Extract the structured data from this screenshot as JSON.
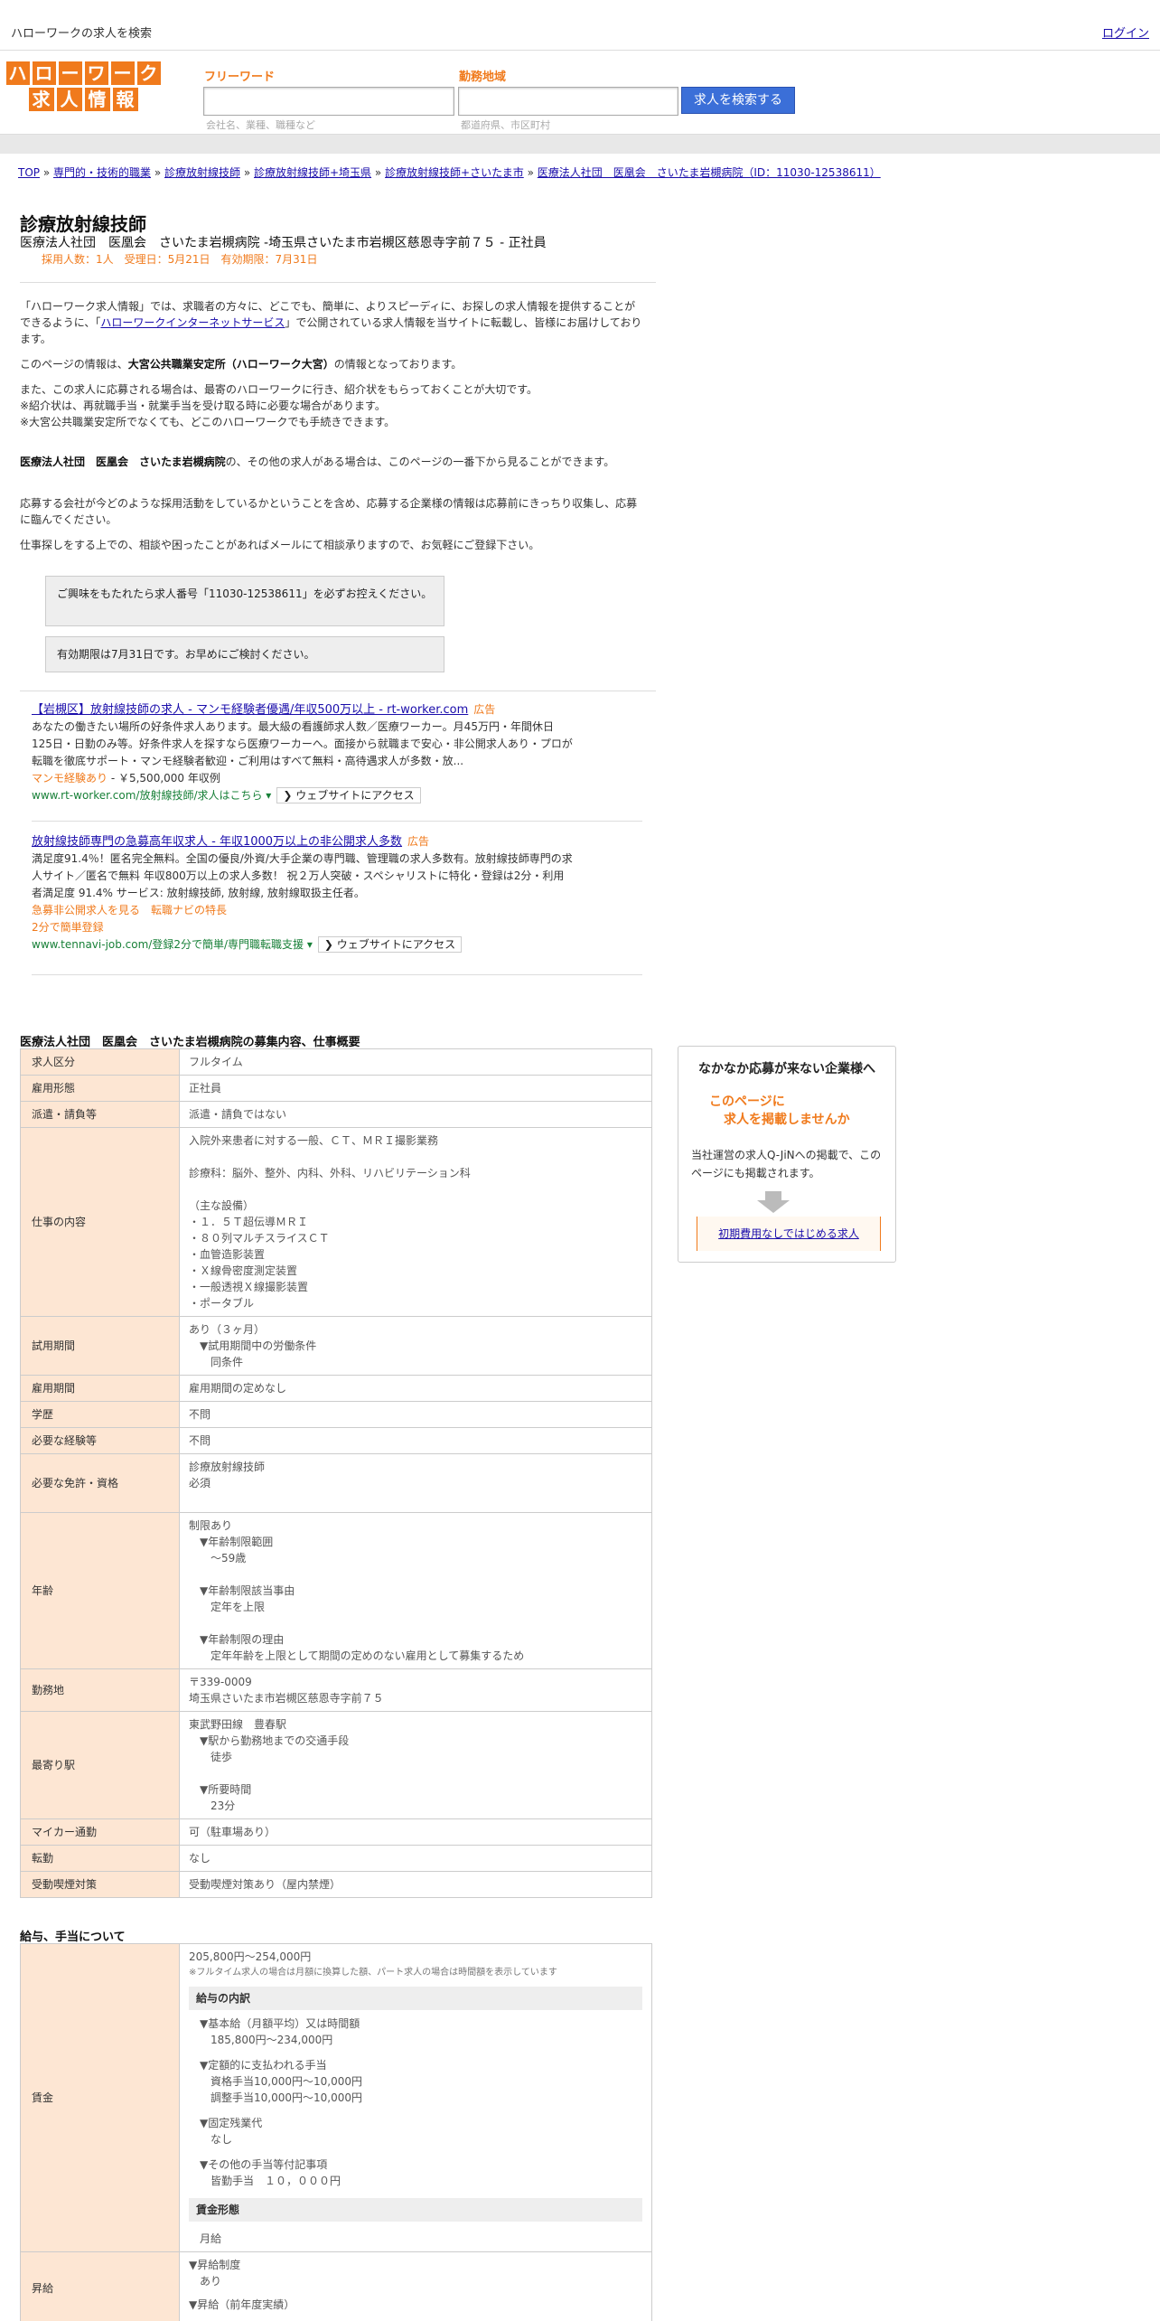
{
  "topbar": {
    "title": "ハローワークの求人を検索",
    "login": "ログイン"
  },
  "logo": {
    "row1": [
      "ハ",
      "ロ",
      "ー",
      "ワ",
      "ー",
      "ク"
    ],
    "row2": [
      "求",
      "人",
      "情",
      "報"
    ]
  },
  "search": {
    "freeword_label": "フリーワード",
    "freeword_hint": "会社名、業種、職種など",
    "area_label": "勤務地域",
    "area_hint": "都道府県、市区町村",
    "button": "求人を検索する"
  },
  "breadcrumb": {
    "items": [
      "TOP",
      "専門的・技術的職業",
      "診療放射線技師",
      "診療放射線技師+埼玉県",
      "診療放射線技師+さいたま市",
      "医療法人社団　医凰会　さいたま岩槻病院（ID：11030-12538611）"
    ],
    "sep": "»"
  },
  "job": {
    "title": "診療放射線技師",
    "subtitle": "医療法人社団　医凰会　さいたま岩槻病院 -埼玉県さいたま市岩槻区慈恩寺字前７５ - 正社員",
    "meta": "採用人数：1人　受理日：5月21日　有効期限：7月31日"
  },
  "intro": {
    "p1a": "「ハローワーク求人情報」では、求職者の方々に、どこでも、簡単に、よりスピーディに、お探しの求人情報を提供することができるように、「",
    "p1link": "ハローワークインターネットサービス",
    "p1b": "」で公開されている求人情報を当サイトに転載し、皆様にお届けしております。",
    "p2a": "このページの情報は、",
    "p2b": "大宮公共職業安定所（ハローワーク大宮）",
    "p2c": "の情報となっております。",
    "p3": [
      "また、この求人に応募される場合は、最寄のハローワークに行き、紹介状をもらっておくことが大切です。",
      "※紹介状は、再就職手当・就業手当を受け取る時に必要な場合があります。",
      "※大宮公共職業安定所でなくても、どこのハローワークでも手続きできます。"
    ],
    "p4a": "医療法人社団　医凰会　さいたま岩槻病院",
    "p4b": "の、その他の求人がある場合は、このページの一番下から見ることができます。",
    "p5": "応募する会社が今どのような採用活動をしているかということを含め、応募する企業様の情報は応募前にきっちり収集し、応募に臨んでください。",
    "p6": "仕事探しをする上での、相談や困ったことがあればメールにて相談承りますので、お気軽にご登録下さい。"
  },
  "notice": {
    "box1": "ご興味をもたれたら求人番号「11030-12538611」を必ずお控えください。",
    "box2": "有効期限は7月31日です。お早めにご検討ください。"
  },
  "ads": [
    {
      "title": "【岩槻区】放射線技師の求人 - マンモ経験者優遇/年収500万以上 - rt-worker.com",
      "badge": "広告",
      "desc": "あなたの働きたい場所の好条件求人あります。最大級の看護師求人数／医療ワーカー。月45万円・年間休日125日・日勤のみ等。好条件求人を探すなら医療ワーカーへ。面接から就職まで安心・非公開求人あり・プロが転職を徹底サポート・マンモ経験者歓迎・ご利用はすべて無料・高待遇求人が多数・放...",
      "ext1": "マンモ経験あり",
      "ext1b": " - ￥5,500,000 年収例",
      "ext2": "",
      "url": "www.rt-worker.com/放射線技師/求人はこちら",
      "visit": "❯ ウェブサイトにアクセス"
    },
    {
      "title": "放射線技師専門の急募高年収求人 - 年収1000万以上の非公開求人多数",
      "badge": "広告",
      "desc": "満足度91.4％！匿名完全無料。全国の優良/外資/大手企業の専門職、管理職の求人多数有。放射線技師専門の求人サイト／匿名で無料 年収800万以上の求人多数！ 祝２万人突破・スペシャリストに特化・登録は2分・利用者満足度 91.4% サービス: 放射線技師, 放射線, 放射線取扱主任者。",
      "ext1": "急募非公開求人を見る　転職ナビの特長",
      "ext1b": "",
      "ext2": "2分で簡単登録",
      "url": "www.tennavi-job.com/登録2分で簡単/専門職転職支援",
      "visit": "❯ ウェブサイトにアクセス"
    }
  ],
  "sections": {
    "main": "医療法人社団　医凰会　さいたま岩槻病院の募集内容、仕事概要",
    "salary": "給与、手当について"
  },
  "table1": [
    {
      "k": "求人区分",
      "v": [
        "フルタイム"
      ]
    },
    {
      "k": "雇用形態",
      "v": [
        "正社員"
      ]
    },
    {
      "k": "派遣・請負等",
      "v": [
        "派遣・請負ではない"
      ]
    },
    {
      "k": "仕事の内容",
      "v": [
        "入院外来患者に対する一般、ＣＴ、ＭＲＩ撮影業務",
        "",
        "診療科：脳外、整外、内科、外科、リハビリテーション科",
        "",
        "（主な設備）",
        "・１．５Ｔ超伝導ＭＲＩ",
        "・８０列マルチスライスＣＴ",
        "・血管造影装置",
        "・Ｘ線骨密度測定装置",
        "・一般透視Ｘ線撮影装置",
        "・ポータブル"
      ]
    },
    {
      "k": "試用期間",
      "v": [
        "あり（３ヶ月）",
        "　▼試用期間中の労働条件",
        "　　同条件"
      ]
    },
    {
      "k": "雇用期間",
      "v": [
        "雇用期間の定めなし"
      ]
    },
    {
      "k": "学歴",
      "v": [
        "不問"
      ]
    },
    {
      "k": "必要な経験等",
      "v": [
        "不問"
      ]
    },
    {
      "k": "必要な免許・資格",
      "v": [
        "診療放射線技師",
        "必須",
        ""
      ]
    },
    {
      "k": "年齢",
      "v": [
        "制限あり",
        "　▼年齢制限範囲",
        "　　〜59歳",
        "",
        "　▼年齢制限該当事由",
        "　　定年を上限",
        "",
        "　▼年齢制限の理由",
        "　　定年年齢を上限として期間の定めのない雇用として募集するため"
      ]
    },
    {
      "k": "勤務地",
      "v": [
        "〒339-0009",
        "埼玉県さいたま市岩槻区慈恩寺字前７５"
      ]
    },
    {
      "k": "最寄り駅",
      "v": [
        "東武野田線　豊春駅",
        "　▼駅から勤務地までの交通手段",
        "　　徒歩",
        "",
        "　▼所要時間",
        "　　23分"
      ]
    },
    {
      "k": "マイカー通勤",
      "v": [
        "可（駐車場あり）"
      ]
    },
    {
      "k": "転勤",
      "v": [
        "なし"
      ]
    },
    {
      "k": "受動喫煙対策",
      "v": [
        "受動喫煙対策あり（屋内禁煙）"
      ]
    }
  ],
  "salary": {
    "label": "賃金",
    "range": "205,800円〜254,000円",
    "note": "※フルタイム求人の場合は月額に換算した額、パート求人の場合は時間額を表示しています",
    "breakdown_title": "給与の内訳",
    "items": [
      [
        "▼基本給（月額平均）又は時間額",
        "185,800円〜234,000円"
      ],
      [
        "▼定額的に支払われる手当",
        "資格手当10,000円〜10,000円",
        "調整手当10,000円〜10,000円"
      ],
      [
        "▼固定残業代",
        "なし"
      ],
      [
        "▼その他の手当等付記事項",
        "皆勤手当　１０，０００円"
      ]
    ],
    "form_title": "賃金形態",
    "form_value": "月給",
    "next_label": "昇給",
    "next_items": [
      "▼昇給制度",
      "あり",
      "▼昇給（前年度実績）"
    ]
  },
  "side": {
    "heading": "なかなか応募が来ない企業様へ",
    "orange1": "このページに",
    "orange2": "求人を掲載しませんか",
    "desc": "当社運営の求人Q-JiNへの掲載で、このページにも掲載されます。",
    "cta": "初期費用なしではじめる求人"
  }
}
